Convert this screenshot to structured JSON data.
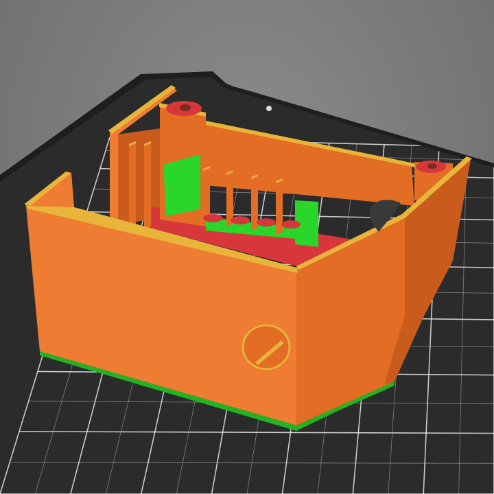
{
  "viewport": {
    "view": "3d-sliced-preview",
    "background_color": "#7a7a7a"
  },
  "bed": {
    "surface_color": "#2b2b2b",
    "grid_color": "#e8e8e8",
    "frame_color": "#1e1e1e"
  },
  "model": {
    "colors": {
      "perimeter": "#e36d25",
      "perimeter_dark": "#c95c1c",
      "perimeter_light": "#ee7d33",
      "top_edge": "#e8b43a",
      "solid_infill": "#d7373a",
      "support_interface": "#2bd62b",
      "first_layer": "#22b222"
    }
  }
}
